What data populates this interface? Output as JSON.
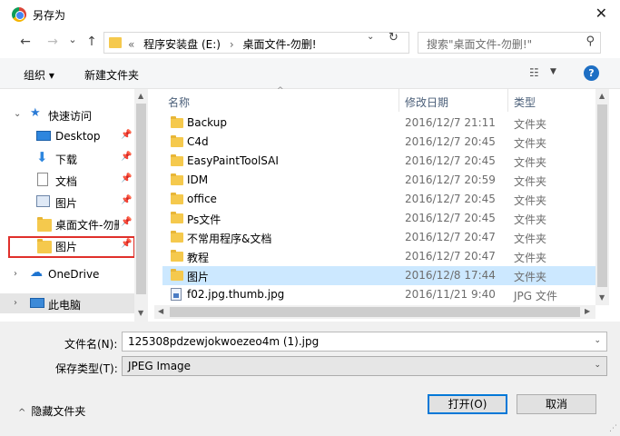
{
  "window": {
    "title": "另存为",
    "close": "✕"
  },
  "nav_buttons": {
    "back": "←",
    "forward": "→",
    "recent": "⌄",
    "up": "↑"
  },
  "address": {
    "overflow": "«",
    "segments": [
      "程序安装盘 (E:)",
      "桌面文件-勿删!"
    ],
    "separator": "›",
    "dropdown": "⌄",
    "refresh": "↻"
  },
  "search": {
    "placeholder": "搜索\"桌面文件-勿删!\"",
    "icon": "⚲"
  },
  "toolbar": {
    "organize": "组织 ▾",
    "new_folder": "新建文件夹",
    "view": "☷",
    "view_drop": "▼",
    "help": "?"
  },
  "nav_pane": {
    "quick_access": "快速访问",
    "items": [
      {
        "label": "Desktop",
        "icon": "desktop-icon",
        "pinned": true
      },
      {
        "label": "下载",
        "icon": "download-icon",
        "pinned": true
      },
      {
        "label": "文档",
        "icon": "document-icon",
        "pinned": true
      },
      {
        "label": "图片",
        "icon": "pictures-icon",
        "pinned": true
      },
      {
        "label": "桌面文件-勿删",
        "icon": "folder-icon",
        "pinned": true
      },
      {
        "label": "图片",
        "icon": "folder-icon",
        "pinned": true
      }
    ],
    "onedrive": "OneDrive",
    "this_pc": "此电脑",
    "pin_glyph": "📌"
  },
  "columns": {
    "name": "名称",
    "date": "修改日期",
    "type": "类型"
  },
  "files": [
    {
      "name": "Backup",
      "date": "2016/12/7 21:11",
      "type": "文件夹",
      "kind": "folder"
    },
    {
      "name": "C4d",
      "date": "2016/12/7 20:45",
      "type": "文件夹",
      "kind": "folder"
    },
    {
      "name": "EasyPaintToolSAI",
      "date": "2016/12/7 20:45",
      "type": "文件夹",
      "kind": "folder"
    },
    {
      "name": "IDM",
      "date": "2016/12/7 20:59",
      "type": "文件夹",
      "kind": "folder"
    },
    {
      "name": "office",
      "date": "2016/12/7 20:45",
      "type": "文件夹",
      "kind": "folder"
    },
    {
      "name": "Ps文件",
      "date": "2016/12/7 20:45",
      "type": "文件夹",
      "kind": "folder"
    },
    {
      "name": "不常用程序&文档",
      "date": "2016/12/7 20:47",
      "type": "文件夹",
      "kind": "folder"
    },
    {
      "name": "教程",
      "date": "2016/12/7 20:47",
      "type": "文件夹",
      "kind": "folder"
    },
    {
      "name": "图片",
      "date": "2016/12/8 17:44",
      "type": "文件夹",
      "kind": "folder",
      "selected": true
    },
    {
      "name": "f02.jpg.thumb.jpg",
      "date": "2016/11/21 9:40",
      "type": "JPG 文件",
      "kind": "jpg"
    }
  ],
  "save": {
    "filename_label": "文件名(N):",
    "filename_value": "125308pdzewjokwoezeo4m (1).jpg",
    "type_label": "保存类型(T):",
    "type_value": "JPEG Image"
  },
  "footer": {
    "hide_folders": "隐藏文件夹",
    "open": "打开(O)",
    "cancel": "取消"
  }
}
